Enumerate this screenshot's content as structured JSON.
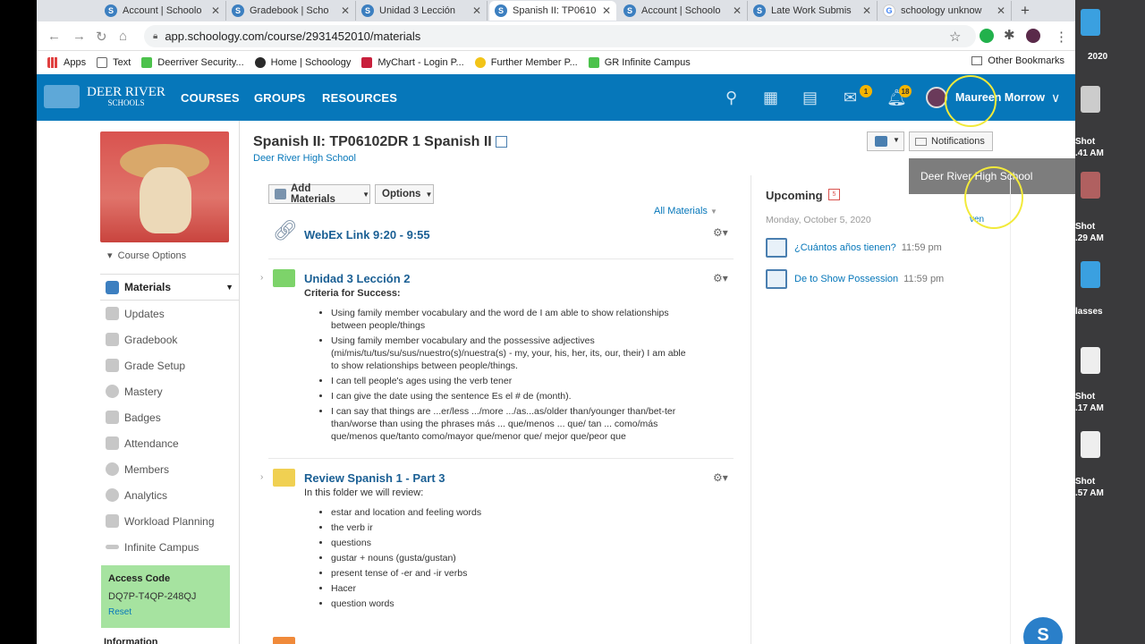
{
  "browser": {
    "tabs": [
      {
        "label": "Account | Schoolo",
        "favicon": "S"
      },
      {
        "label": "Gradebook | Scho",
        "favicon": "S"
      },
      {
        "label": "Unidad 3 Lección",
        "favicon": "S"
      },
      {
        "label": "Spanish II: TP0610",
        "favicon": "S",
        "active": true
      },
      {
        "label": "Account | Schoolo",
        "favicon": "S"
      },
      {
        "label": "Late Work Submis",
        "favicon": "S"
      },
      {
        "label": "schoology unknow",
        "favicon": "G"
      }
    ],
    "url": "app.schoology.com/course/2931452010/materials",
    "bookmarks": [
      "Apps",
      "Text",
      "Deerriver Security...",
      "Home | Schoology",
      "MyChart - Login P...",
      "Further Member P...",
      "GR Infinite Campus"
    ],
    "other_bookmarks": "Other Bookmarks"
  },
  "header": {
    "logo_line1": "DEER RIVER",
    "logo_line2": "SCHOOLS",
    "nav": [
      "COURSES",
      "GROUPS",
      "RESOURCES"
    ],
    "messages_badge": "1",
    "notifications_badge": "18",
    "user_name": "Maureen Morrow",
    "brand_color": "#0677ba"
  },
  "course": {
    "title": "Spanish II: TP06102DR 1 Spanish II",
    "school": "Deer River High School",
    "course_options": "Course Options"
  },
  "sidebar": {
    "items": [
      "Materials",
      "Updates",
      "Gradebook",
      "Grade Setup",
      "Mastery",
      "Badges",
      "Attendance",
      "Members",
      "Analytics",
      "Workload Planning",
      "Infinite Campus"
    ],
    "access_code_title": "Access Code",
    "access_code": "DQ7P-T4QP-248QJ",
    "reset": "Reset",
    "information": "Information"
  },
  "toolbar": {
    "add_materials": "Add Materials",
    "options": "Options",
    "all_materials": "All Materials",
    "notifications": "Notifications",
    "dropdown_item": "Deer River High School"
  },
  "materials": [
    {
      "title": "WebEx Link 9:20 - 9:55"
    },
    {
      "title": "Unidad 3 Lección 2",
      "subtitle": "Criteria for Success:",
      "bullets": [
        "Using family member vocabulary and the word de I am able to show relationships between people/things",
        "Using family member vocabulary and the possessive adjectives (mi/mis/tu/tus/su/sus/nuestro(s)/nuestra(s) - my, your, his, her, its, our, their) I am able to show relationships between people/things.",
        "I can tell people's ages using the verb tener",
        "I can give the date using the sentence Es el # de (month).",
        "I can say that things are ...er/less .../more .../as...as/older than/younger than/bet-ter than/worse than using the phrases más ... que/menos ... que/ tan ... como/más que/menos que/tanto como/mayor que/menor que/ mejor que/peor que"
      ]
    },
    {
      "title": "Review Spanish 1 - Part 3",
      "subtitle": "In this folder we will review:",
      "bullets": [
        "estar and location and feeling words",
        "the verb ir",
        "questions",
        "gustar + nouns (gusta/gustan)",
        "present tense of -er and -ir verbs",
        "Hacer",
        "question words"
      ]
    }
  ],
  "upcoming": {
    "title": "Upcoming",
    "calendar_day": "5",
    "date": "Monday, October 5, 2020",
    "view": "ven",
    "events": [
      {
        "title": "¿Cuántos años tienen?",
        "time": "11:59 pm"
      },
      {
        "title": "De to Show Possession",
        "time": "11:59 pm"
      }
    ]
  },
  "desktop": {
    "labels": [
      "2020",
      "Shot",
      ".41 AM",
      "Shot",
      ".29 AM",
      "lasses",
      "Shot",
      ".17 AM",
      "Shot",
      ".57 AM"
    ]
  },
  "chat_button": "S"
}
